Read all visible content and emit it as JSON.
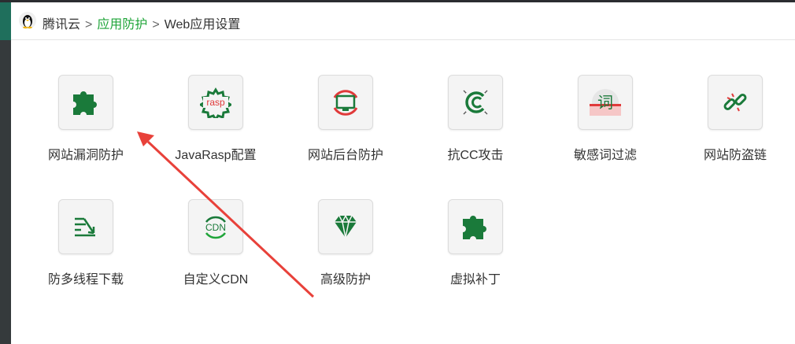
{
  "breadcrumb": {
    "root": "腾讯云",
    "separator": ">",
    "middle": "应用防护",
    "current": "Web应用设置"
  },
  "tiles": [
    {
      "label": "网站漏洞防护",
      "icon": "puzzle-icon"
    },
    {
      "label": "JavaRasp配置",
      "icon": "rasp-gear-icon",
      "icon_text": "rasp"
    },
    {
      "label": "网站后台防护",
      "icon": "monitor-shield-icon"
    },
    {
      "label": "抗CC攻击",
      "icon": "cc-icon"
    },
    {
      "label": "敏感词过滤",
      "icon": "sensitive-word-icon",
      "icon_text": "词"
    },
    {
      "label": "网站防盗链",
      "icon": "broken-link-icon"
    },
    {
      "label": "防多线程下载",
      "icon": "multi-thread-icon"
    },
    {
      "label": "自定义CDN",
      "icon": "cdn-icon",
      "icon_text": "CDN"
    },
    {
      "label": "高级防护",
      "icon": "diamond-icon"
    },
    {
      "label": "虚拟补丁",
      "icon": "puzzle-icon"
    }
  ],
  "colors": {
    "accent": "#20a53a",
    "icon_green": "#1a7a3a",
    "icon_red": "#e03a3a",
    "annotation_arrow": "#e8413a"
  }
}
